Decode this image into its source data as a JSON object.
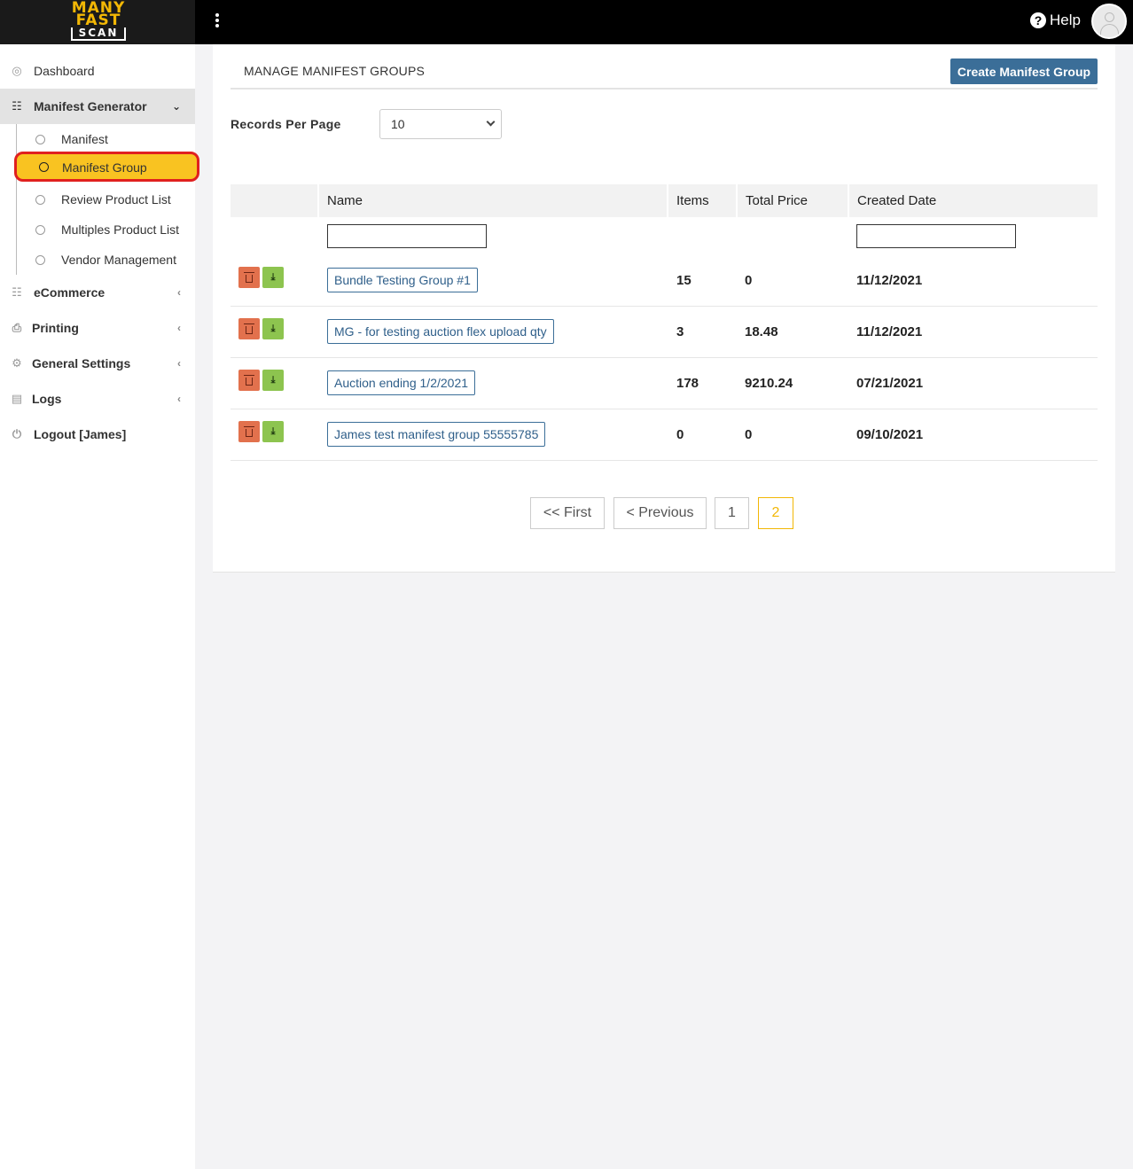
{
  "app": {
    "logo_line1": "MANY",
    "logo_line2": "FAST",
    "logo_line3": "SCAN",
    "help_label": "Help"
  },
  "sidebar": {
    "dashboard": "Dashboard",
    "manifest_generator": "Manifest Generator",
    "sub_items": [
      "Manifest",
      "Manifest Group",
      "Review Product List",
      "Multiples Product List",
      "Vendor Management"
    ],
    "ecommerce": "eCommerce",
    "printing": "Printing",
    "general_settings": "General Settings",
    "logs": "Logs",
    "logout": "Logout [James]"
  },
  "main": {
    "title": "MANAGE MANIFEST GROUPS",
    "create_button": "Create Manifest Group",
    "records_per_page_label": "Records Per Page",
    "records_per_page_value": "10",
    "columns": [
      "Name",
      "Items",
      "Total Price",
      "Created Date"
    ],
    "rows": [
      {
        "name": "Bundle Testing Group #1",
        "items": "15",
        "total_price": "0",
        "created": "11/12/2021"
      },
      {
        "name": "MG - for testing auction flex upload qty",
        "items": "3",
        "total_price": "18.48",
        "created": "11/12/2021"
      },
      {
        "name": "Auction ending 1/2/2021",
        "items": "178",
        "total_price": "9210.24",
        "created": "07/21/2021"
      },
      {
        "name": "James test manifest group 55555785",
        "items": "0",
        "total_price": "0",
        "created": "09/10/2021"
      }
    ],
    "pagination": {
      "first": "<< First",
      "previous": "< Previous",
      "pages": [
        "1",
        "2"
      ],
      "current": "2"
    }
  },
  "colors": {
    "accent": "#3b6e98",
    "highlight": "#f9c321",
    "delete": "#e2714d",
    "download": "#8dc44f"
  }
}
